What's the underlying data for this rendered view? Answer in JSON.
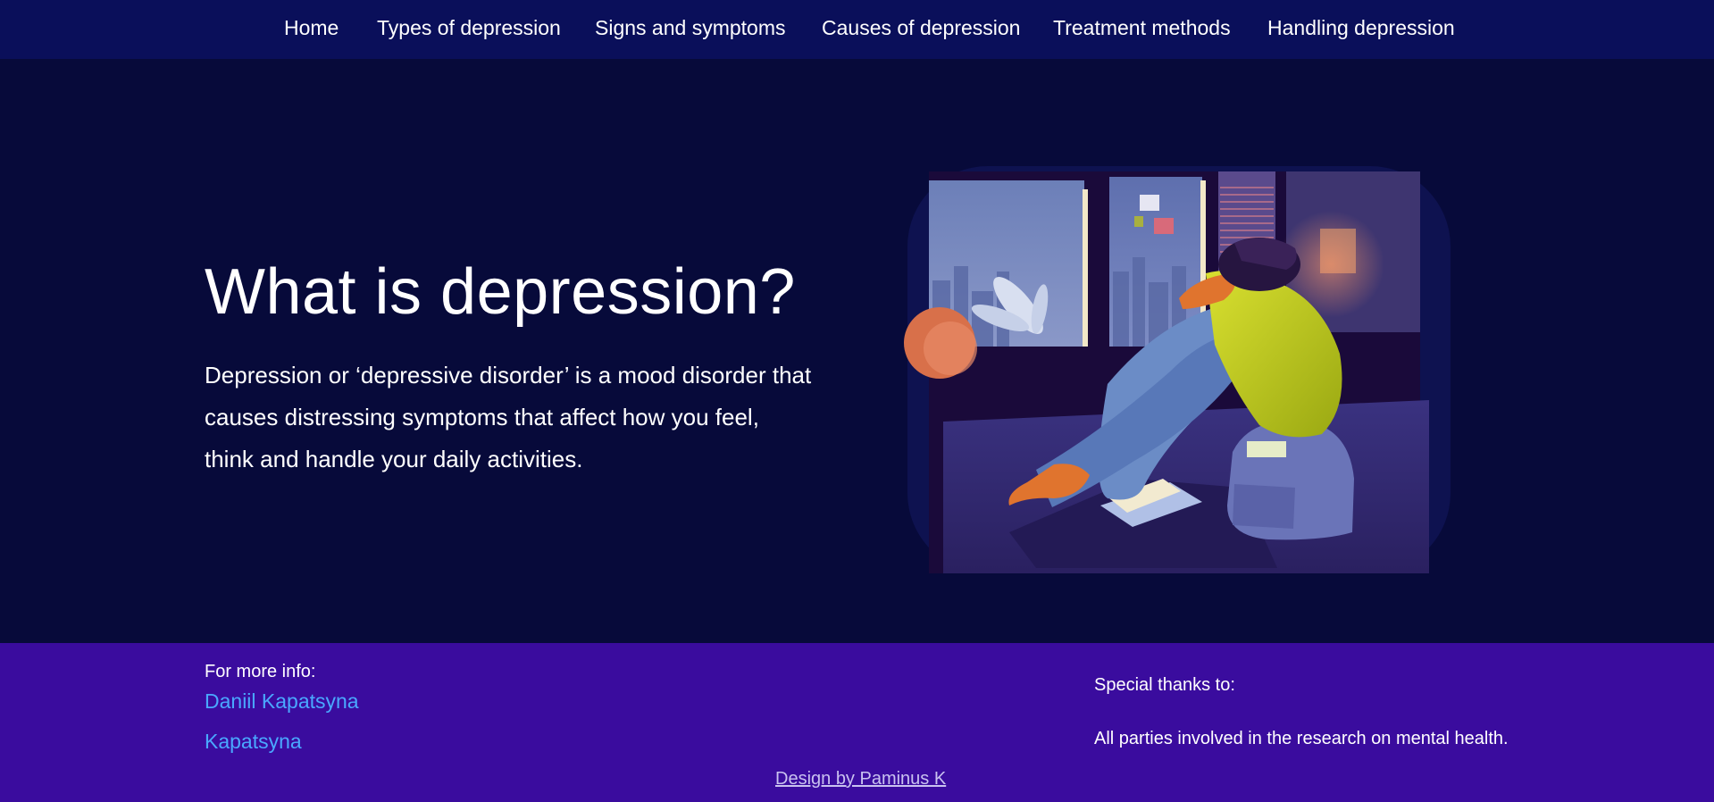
{
  "nav": {
    "items": [
      {
        "label": "Home"
      },
      {
        "label": "Types of depression"
      },
      {
        "label": "Signs and symptoms"
      },
      {
        "label": "Causes of depression"
      },
      {
        "label": "Treatment methods"
      },
      {
        "label": "Handling depression"
      }
    ]
  },
  "hero": {
    "title": "What is depression?",
    "text": "Depression or ‘depressive disorder’ is a mood disorder that causes distressing symptoms that affect how you feel, think and handle your daily activities."
  },
  "illustration": {
    "icon": "person-sitting-sad-illustration"
  },
  "footer": {
    "info_label": "For more info:",
    "links": [
      {
        "label": "Daniil Kapatsyna"
      },
      {
        "label": "Kapatsyna"
      }
    ],
    "thanks_label": "Special thanks to:",
    "thanks_text": "All parties involved in the research on mental health.",
    "credit": "Design by Paminus K"
  },
  "colors": {
    "nav_bg": "#0a0f5a",
    "hero_bg": "#070a3a",
    "footer_bg": "#3a0c9e",
    "link": "#4aa8ff"
  }
}
